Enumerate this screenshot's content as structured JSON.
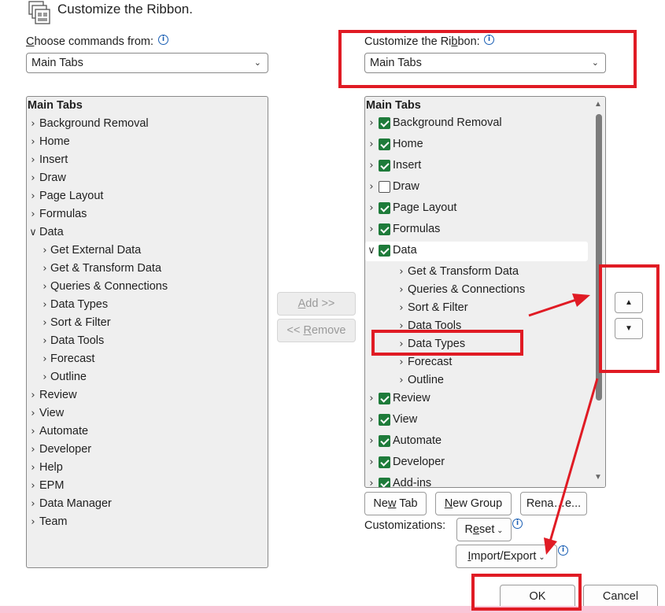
{
  "header": {
    "title": "Customize the Ribbon."
  },
  "left": {
    "label_prefix": "C",
    "label_rest": "hoose commands from:",
    "select_value": "Main Tabs",
    "list": {
      "header": "Main Tabs",
      "items": [
        "Background Removal",
        "Home",
        "Insert",
        "Draw",
        "Page Layout",
        "Formulas",
        "Data",
        "Get External Data",
        "Get & Transform Data",
        "Queries & Connections",
        "Data Types",
        "Sort & Filter",
        "Data Tools",
        "Forecast",
        "Outline",
        "Review",
        "View",
        "Automate",
        "Developer",
        "Help",
        "EPM",
        "Data Manager",
        "Team"
      ]
    }
  },
  "middle": {
    "add_u": "A",
    "add_rest": "dd >>",
    "remove_pre": "<< ",
    "remove_u": "R",
    "remove_rest": "emove"
  },
  "right": {
    "label_pre": "Customize the Ri",
    "label_u": "b",
    "label_rest": "bon:",
    "select_value": "Main Tabs",
    "list": {
      "header": "Main Tabs",
      "items": [
        "Background Removal",
        "Home",
        "Insert",
        "Draw",
        "Page Layout",
        "Formulas",
        "Data",
        "Get & Transform Data",
        "Queries & Connections",
        "Sort & Filter",
        "Data Tools",
        "Data Types",
        "Forecast",
        "Outline",
        "Review",
        "View",
        "Automate",
        "Developer",
        "Add-ins"
      ]
    },
    "new_tab": {
      "pre": "Ne",
      "u": "w",
      "rest": " Tab"
    },
    "new_group": {
      "u": "N",
      "rest": "ew Group"
    },
    "rename": "Rena…e...",
    "customizations_label": "Customizations:",
    "reset": {
      "pre": "R",
      "u": "e",
      "rest": "set"
    },
    "import_export": {
      "u": "I",
      "rest": "mport/Export"
    }
  },
  "footer": {
    "ok": "OK",
    "cancel": "Cancel"
  },
  "colors": {
    "annotation_red": "#e01b24",
    "checkbox_green": "#1e7b3a"
  }
}
